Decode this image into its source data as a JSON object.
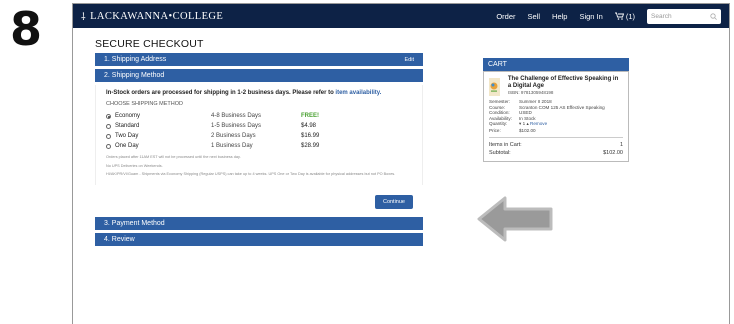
{
  "step_number": "8",
  "header": {
    "logo_text": "LACKAWANNA•COLLEGE",
    "nav": [
      "Order",
      "Sell",
      "Help",
      "Sign In"
    ],
    "cart_count": "(1)",
    "search_placeholder": "Search"
  },
  "checkout": {
    "title": "SECURE CHECKOUT",
    "steps": [
      {
        "label": "1. Shipping Address",
        "action": "Edit"
      },
      {
        "label": "2. Shipping Method"
      },
      {
        "label": "3. Payment Method"
      },
      {
        "label": "4. Review"
      }
    ],
    "notice_text": "In-Stock orders are processed for shipping in 1-2 business days. Please refer to ",
    "notice_link": "item availability.",
    "choose_label": "CHOOSE SHIPPING METHOD",
    "options": [
      {
        "name": "Economy",
        "days": "4-8 Business Days",
        "price": "FREE!",
        "selected": true
      },
      {
        "name": "Standard",
        "days": "1-5 Business Days",
        "price": "$4.98",
        "selected": false
      },
      {
        "name": "Two Day",
        "days": "2 Business Days",
        "price": "$16.99",
        "selected": false
      },
      {
        "name": "One Day",
        "days": "1 Business Day",
        "price": "$28.99",
        "selected": false
      }
    ],
    "fine_print_1": "Orders placed after 11AM EST will not be processed until the next business day.",
    "fine_print_2": "No UPS Deliveries on Weekends.",
    "fine_print_3": "HI/AK/PR/VI/Guam - Shipments via Economy Shipping (Regular USPS) can take up to 4 weeks. UPS One or Two Day is available for physical addresses but not PO Boxes.",
    "continue_label": "Continue"
  },
  "cart": {
    "heading": "CART",
    "book_title": "The Challenge of Effective Speaking in a Digital Age",
    "isbn": "ISBN: 9781305948198",
    "details": [
      {
        "label": "Semester:",
        "value": "Summer II 2018"
      },
      {
        "label": "Course:",
        "value": "Scranton COM 125 AS Effective Speaking"
      },
      {
        "label": "Condition:",
        "value": "USED"
      },
      {
        "label": "Availability:",
        "value": "In Stock"
      },
      {
        "label": "Quantity:",
        "value": "1"
      },
      {
        "label": "Price:",
        "value": "$102.00"
      }
    ],
    "remove_label": "Remove",
    "items_label": "Items in Cart:",
    "items_value": "1",
    "subtotal_label": "Subtotal:",
    "subtotal_value": "$102.00"
  },
  "colors": {
    "navy": "#0d2246",
    "blue": "#2e5fa3",
    "free_green": "#4aa132"
  }
}
